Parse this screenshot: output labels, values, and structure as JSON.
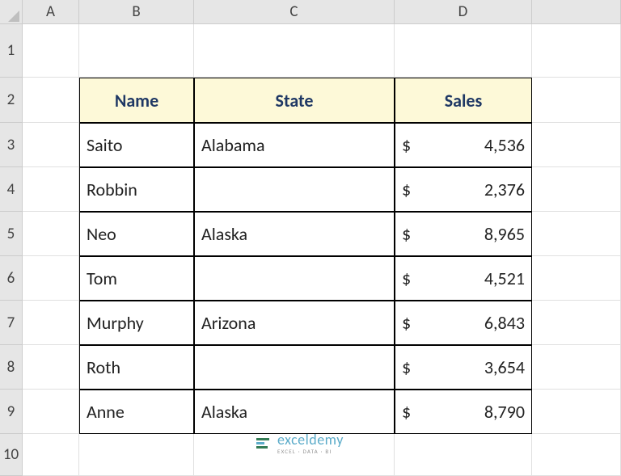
{
  "columns": {
    "A": "A",
    "B": "B",
    "C": "C",
    "D": "D"
  },
  "rows": [
    "1",
    "2",
    "3",
    "4",
    "5",
    "6",
    "7",
    "8",
    "9",
    "10"
  ],
  "headers": {
    "name": "Name",
    "state": "State",
    "sales": "Sales"
  },
  "currency_symbol": "$",
  "data": [
    {
      "name": "Saito",
      "state": "Alabama",
      "sales": "4,536"
    },
    {
      "name": "Robbin",
      "state": "",
      "sales": "2,376"
    },
    {
      "name": "Neo",
      "state": "Alaska",
      "sales": "8,965"
    },
    {
      "name": "Tom",
      "state": "",
      "sales": "4,521"
    },
    {
      "name": "Murphy",
      "state": "Arizona",
      "sales": "6,843"
    },
    {
      "name": "Roth",
      "state": "",
      "sales": "3,654"
    },
    {
      "name": "Anne",
      "state": "Alaska",
      "sales": "8,790"
    }
  ],
  "watermark": {
    "title": "exceldemy",
    "subtitle": "EXCEL · DATA · BI"
  },
  "chart_data": {
    "type": "table",
    "title": "",
    "columns": [
      "Name",
      "State",
      "Sales"
    ],
    "rows": [
      [
        "Saito",
        "Alabama",
        4536
      ],
      [
        "Robbin",
        "",
        2376
      ],
      [
        "Neo",
        "Alaska",
        8965
      ],
      [
        "Tom",
        "",
        4521
      ],
      [
        "Murphy",
        "Arizona",
        6843
      ],
      [
        "Roth",
        "",
        3654
      ],
      [
        "Anne",
        "Alaska",
        8790
      ]
    ]
  }
}
